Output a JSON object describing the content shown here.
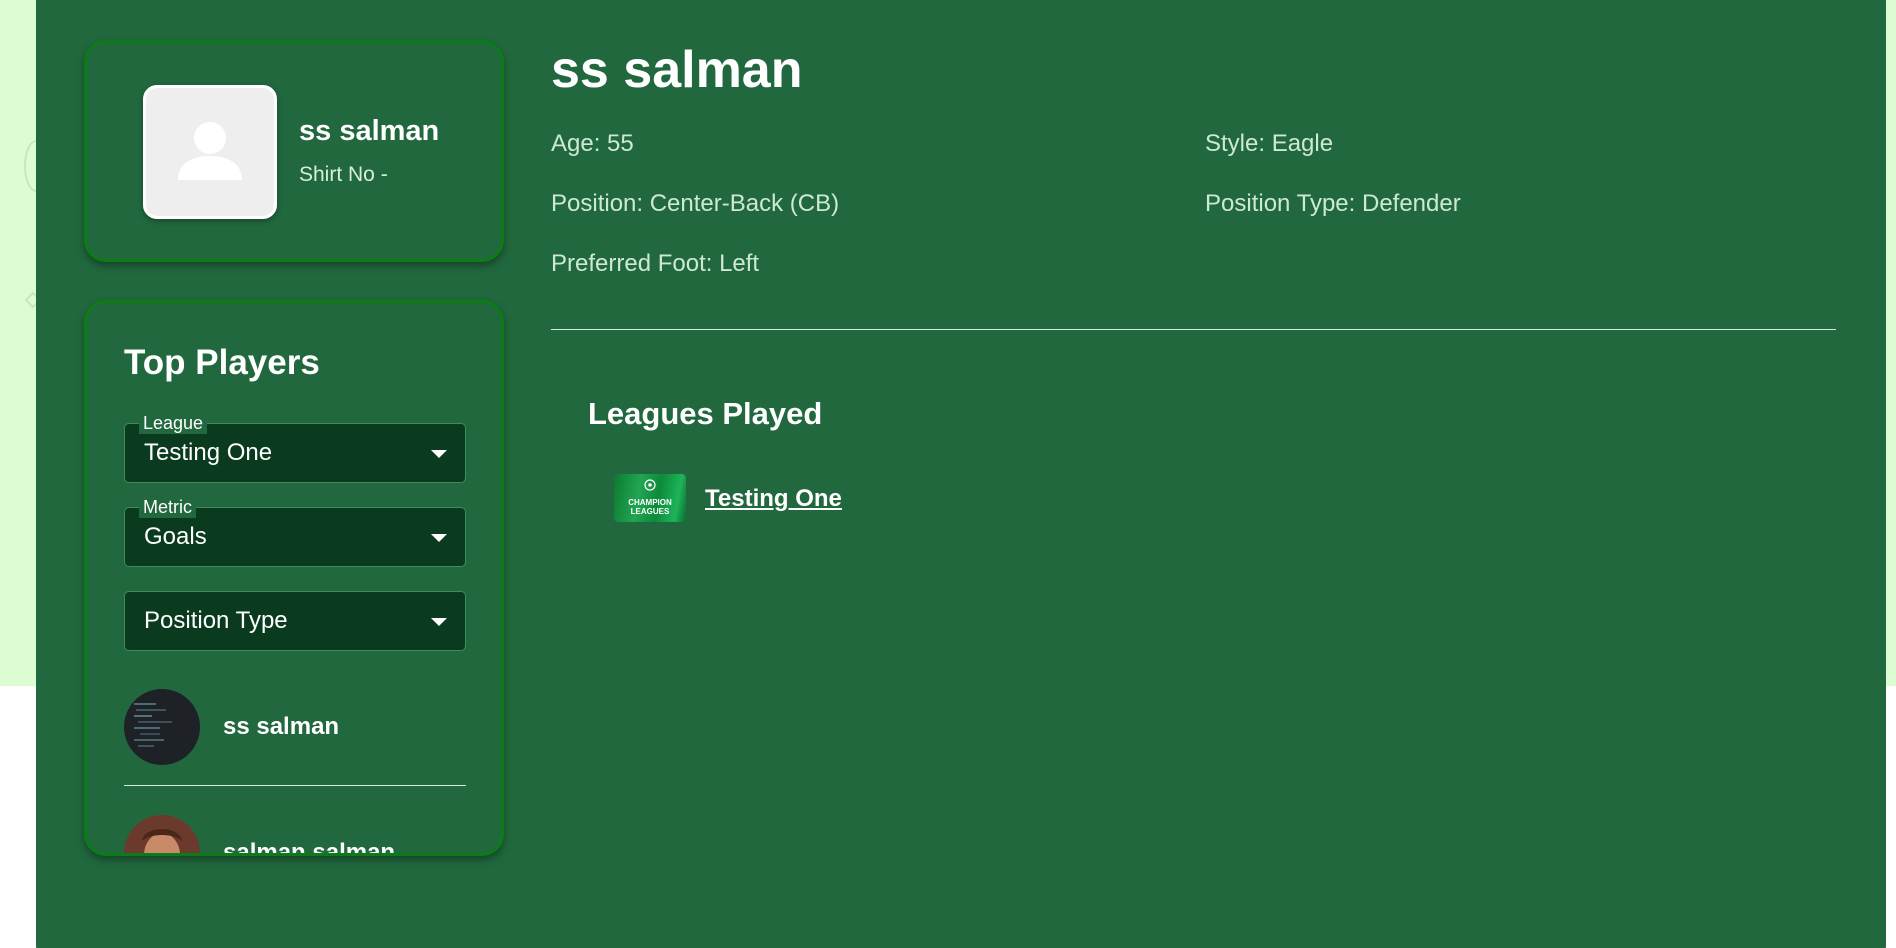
{
  "colors": {
    "page_background": "#dcfdd4",
    "card_background": "#21683e",
    "card_border": "#0c7c16",
    "select_background": "#0a3b1e",
    "text_primary": "#ffffff",
    "text_secondary": "#cde8d4"
  },
  "profile": {
    "name": "ss salman",
    "shirt": "Shirt No -",
    "avatar_icon": "person-placeholder-icon"
  },
  "top_players": {
    "title": "Top Players",
    "filters": {
      "league": {
        "label": "League",
        "value": "Testing One"
      },
      "metric": {
        "label": "Metric",
        "value": "Goals"
      },
      "position_type": {
        "label": "",
        "value": "Position Type"
      }
    },
    "players": [
      {
        "name": "ss salman"
      },
      {
        "name": "salman salman"
      }
    ]
  },
  "player_details": {
    "name": "ss salman",
    "age": "Age: 55",
    "style": "Style: Eagle",
    "position": "Position: Center-Back (CB)",
    "position_type": "Position Type: Defender",
    "preferred_foot": "Preferred Foot: Left"
  },
  "leagues": {
    "title": "Leagues Played",
    "items": [
      {
        "name": "Testing One",
        "logo_text_1": "CHAMPION",
        "logo_text_2": "LEAGUES"
      }
    ]
  }
}
